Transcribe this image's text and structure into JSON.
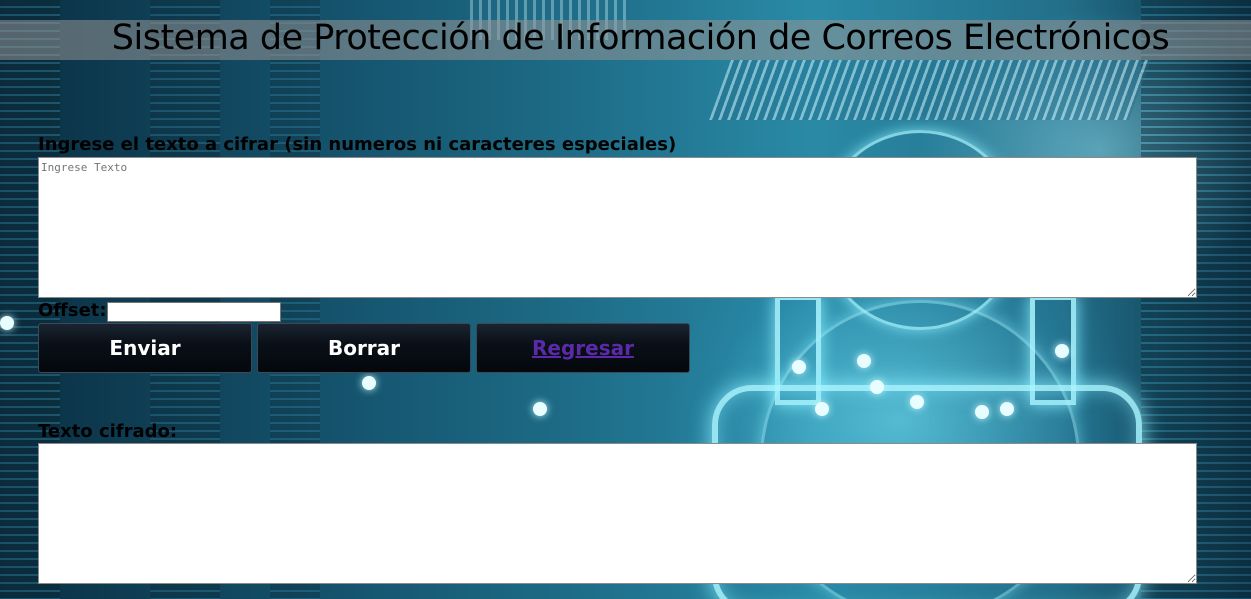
{
  "header": {
    "title": "Sistema de Protección de Información de Correos Electrónicos"
  },
  "form": {
    "input_label": "Ingrese el texto a cifrar (sin numeros ni caracteres especiales)",
    "input_placeholder": "Ingrese Texto",
    "offset_label": "Offset:",
    "offset_value": "",
    "output_label": "Texto cifrado:",
    "output_value": ""
  },
  "buttons": {
    "send_label": "Enviar",
    "clear_label": "Borrar",
    "back_label": "Regresar"
  },
  "colors": {
    "link": "#5a2aa8",
    "button_bg": "#0a1018",
    "title_bar": "#969696"
  }
}
